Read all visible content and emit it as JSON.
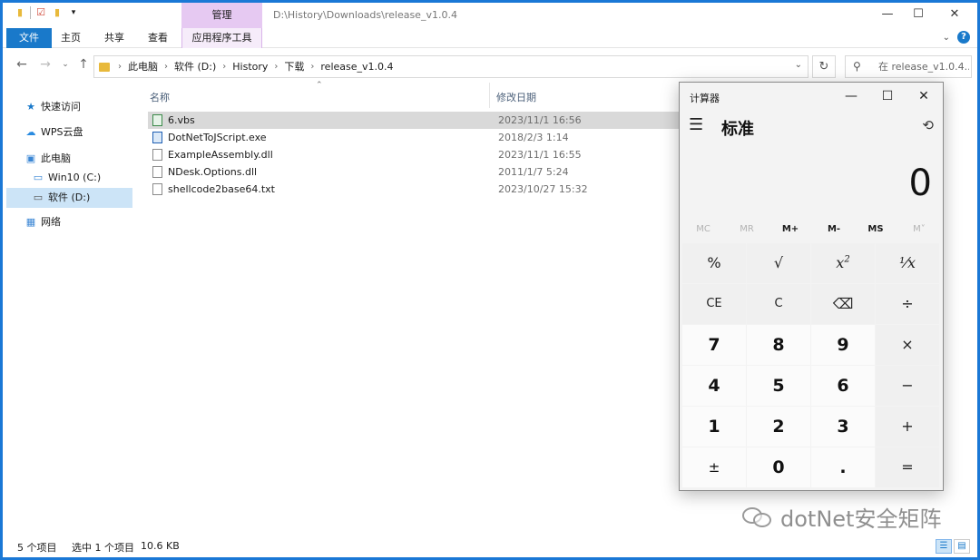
{
  "titlebar": {
    "manage_tab": "管理",
    "path": "D:\\History\\Downloads\\release_v1.0.4",
    "minimize": "—",
    "maximize": "☐",
    "close": "✕"
  },
  "ribbon": {
    "tabs": [
      "文件",
      "主页",
      "共享",
      "查看",
      "应用程序工具"
    ]
  },
  "address": {
    "crumbs": [
      "此电脑",
      "软件 (D:)",
      "History",
      "下载",
      "release_v1.0.4"
    ],
    "search_placeholder": "在 release_v1.0.4..."
  },
  "sidebar": {
    "items": [
      {
        "label": "快速访问",
        "icon": "star-icon"
      },
      {
        "label": "WPS云盘",
        "icon": "cloud-icon"
      },
      {
        "label": "此电脑",
        "icon": "computer-icon"
      },
      {
        "label": "Win10 (C:)",
        "icon": "drive-icon"
      },
      {
        "label": "软件 (D:)",
        "icon": "drive-icon"
      },
      {
        "label": "网络",
        "icon": "network-icon"
      }
    ]
  },
  "filelist": {
    "col_name": "名称",
    "col_date": "修改日期",
    "files": [
      {
        "name": "6.vbs",
        "date": "2023/11/1 16:56"
      },
      {
        "name": "DotNetToJScript.exe",
        "date": "2018/2/3 1:14"
      },
      {
        "name": "ExampleAssembly.dll",
        "date": "2023/11/1 16:55"
      },
      {
        "name": "NDesk.Options.dll",
        "date": "2011/1/7 5:24"
      },
      {
        "name": "shellcode2base64.txt",
        "date": "2023/10/27 15:32"
      }
    ]
  },
  "statusbar": {
    "count": "5 个项目",
    "selected": "选中 1 个项目",
    "size": "10.6 KB"
  },
  "calculator": {
    "title": "计算器",
    "mode": "标准",
    "display": "0",
    "memory": [
      "MC",
      "MR",
      "M+",
      "M-",
      "MS",
      "M˅"
    ],
    "keys": [
      "%",
      "√",
      "x",
      "¹⁄x",
      "CE",
      "C",
      "⌫",
      "÷",
      "7",
      "8",
      "9",
      "×",
      "4",
      "5",
      "6",
      "−",
      "1",
      "2",
      "3",
      "+",
      "±",
      "0",
      ".",
      "="
    ]
  },
  "watermark": "dotNet安全矩阵"
}
